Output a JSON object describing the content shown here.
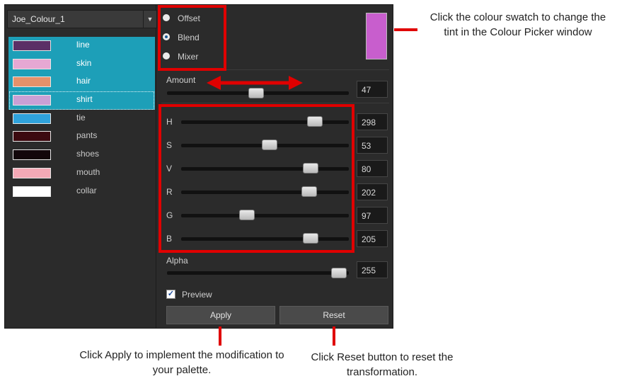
{
  "palette": {
    "name": "Joe_Colour_1",
    "dropdown_icon": "chevron-down-icon",
    "colours": [
      {
        "label": "line",
        "color": "#5b2f66",
        "selected": true
      },
      {
        "label": "skin",
        "color": "#e6a8d3",
        "selected": true
      },
      {
        "label": "hair",
        "color": "#e5916a",
        "selected": true
      },
      {
        "label": "shirt",
        "color": "#c9a0d5",
        "selected": true,
        "focused": true
      },
      {
        "label": "tie",
        "color": "#2fa3dc",
        "selected": false
      },
      {
        "label": "pants",
        "color": "#3c0a10",
        "selected": false
      },
      {
        "label": "shoes",
        "color": "#12060a",
        "selected": false
      },
      {
        "label": "mouth",
        "color": "#f4a9b6",
        "selected": false
      },
      {
        "label": "collar",
        "color": "#ffffff",
        "selected": false
      }
    ]
  },
  "modes": {
    "options": [
      "Offset",
      "Blend",
      "Mixer"
    ],
    "selected": "Blend"
  },
  "tint_swatch_color": "#c85ecd",
  "amount": {
    "label": "Amount",
    "value": "47",
    "level": 0.5
  },
  "channels": [
    {
      "label": "H",
      "value": "298",
      "level": 0.83
    },
    {
      "label": "S",
      "value": "53",
      "level": 0.53
    },
    {
      "label": "V",
      "value": "80",
      "level": 0.8
    },
    {
      "label": "R",
      "value": "202",
      "level": 0.79
    },
    {
      "label": "G",
      "value": "97",
      "level": 0.38
    },
    {
      "label": "B",
      "value": "205",
      "level": 0.8
    }
  ],
  "alpha": {
    "label": "Alpha",
    "value": "255",
    "level": 1.0
  },
  "preview": {
    "label": "Preview",
    "checked": true
  },
  "buttons": {
    "apply": "Apply",
    "reset": "Reset"
  },
  "annotations": {
    "swatch": "Click the colour swatch to change the tint in the Colour Picker window",
    "apply": "Click Apply to implement the modification to your palette.",
    "reset": "Click Reset button to reset the transformation."
  },
  "highlight_color": "#e00000"
}
